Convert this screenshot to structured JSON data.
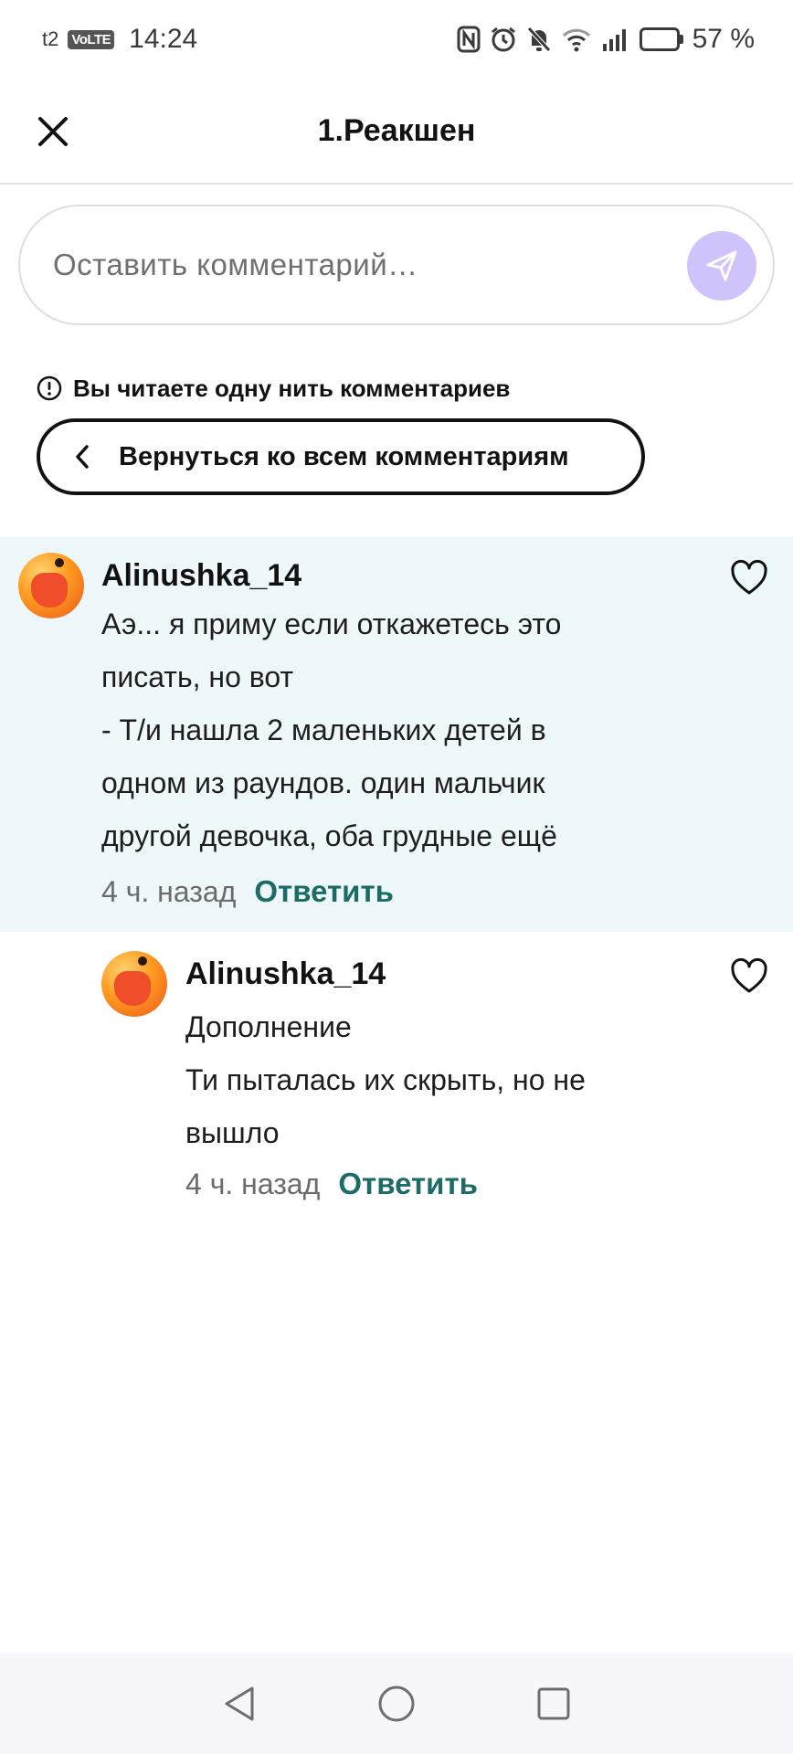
{
  "status_bar": {
    "carrier": "t2",
    "network_badge": "VoLTE",
    "time": "14:24",
    "battery": "57 %",
    "battery_level": 0.57,
    "icons": [
      "nfc-icon",
      "alarm-icon",
      "mute-icon",
      "wifi-icon",
      "signal-icon",
      "battery-icon"
    ]
  },
  "header": {
    "title": "1.Реакшен",
    "close_icon": "close-icon"
  },
  "comment_input": {
    "placeholder": "Оставить комментарий…",
    "send_icon": "send-icon"
  },
  "thread_notice": {
    "text": "Вы читаете одну нить комментариев",
    "icon": "info-icon"
  },
  "back_button": {
    "label": "Вернуться ко всем комментариям",
    "icon": "chevron-left-icon"
  },
  "comments": [
    {
      "username": "Alinushka_14",
      "lines": [
        "Аэ... я приму если откажетесь это",
        "писать, но вот",
        "- Т/и нашла 2 маленьких детей в",
        "одном из раундов. один мальчик",
        "другой девочка, оба грудные ещё"
      ],
      "time": "4 ч. назад",
      "reply_label": "Ответить",
      "highlighted": true
    },
    {
      "username": "Alinushka_14",
      "lines": [
        "Дополнение",
        "Ти пыталась их скрыть, но не",
        "вышло"
      ],
      "time": "4 ч. назад",
      "reply_label": "Ответить",
      "highlighted": false
    }
  ],
  "colors": {
    "accent_reply": "#1d6b66",
    "send_button": "#cfc3fb",
    "highlight_bg": "#eef8fb"
  },
  "nav_bar": {
    "icons": [
      "back-triangle-icon",
      "home-circle-icon",
      "recents-square-icon"
    ]
  }
}
